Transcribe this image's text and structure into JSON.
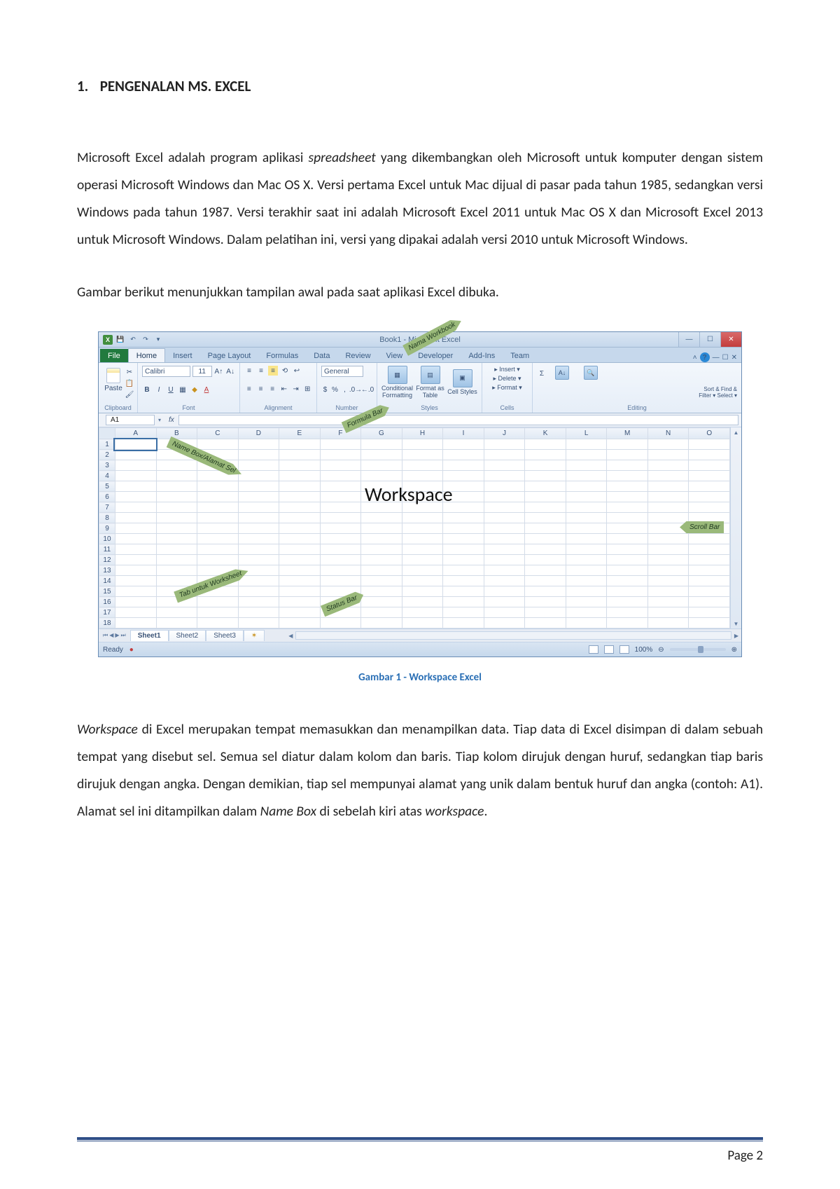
{
  "heading": {
    "number": "1.",
    "text": "PENGENALAN MS. EXCEL"
  },
  "para1_pre": "Microsoft Excel adalah program aplikasi ",
  "para1_it1": "spreadsheet",
  "para1_post": " yang dikembangkan oleh Microsoft untuk komputer dengan sistem operasi Microsoft Windows dan Mac OS X. Versi pertama Excel untuk Mac dijual di pasar pada tahun 1985, sedangkan versi Windows pada tahun 1987. Versi terakhir saat ini adalah Microsoft Excel 2011 untuk Mac OS X dan Microsoft Excel 2013 untuk Microsoft Windows. Dalam pelatihan ini, versi yang dipakai adalah versi 2010 untuk Microsoft Windows.",
  "para2": "Gambar berikut menunjukkan tampilan awal pada saat aplikasi Excel dibuka.",
  "caption": "Gambar 1 - Workspace Excel",
  "para3": {
    "it1": "Workspace",
    "seg1": " di Excel merupakan tempat memasukkan dan menampilkan data. Tiap data di Excel disimpan di dalam sebuah tempat yang disebut sel. Semua sel diatur dalam kolom dan baris. Tiap kolom dirujuk dengan huruf, sedangkan tiap baris dirujuk dengan angka. Dengan demikian, tiap sel mempunyai alamat yang unik dalam bentuk huruf dan angka (contoh: A1). Alamat sel ini ditampilkan dalam ",
    "it2": "Name Box",
    "seg2": " di sebelah kiri atas ",
    "it3": "workspace",
    "seg3": "."
  },
  "page_num": "Page 2",
  "excel": {
    "title": "Book1 - Microsoft Excel",
    "tabs": [
      "File",
      "Home",
      "Insert",
      "Page Layout",
      "Formulas",
      "Data",
      "Review",
      "View",
      "Developer",
      "Add-Ins",
      "Team"
    ],
    "active_tab": "Home",
    "groups": {
      "clipboard": "Clipboard",
      "paste": "Paste",
      "font": "Font",
      "font_name": "Calibri",
      "font_size": "11",
      "alignment": "Alignment",
      "number": "Number",
      "number_format": "General",
      "styles": "Styles",
      "cond_fmt": "Conditional Formatting",
      "fmt_table": "Format as Table",
      "cell_styles": "Cell Styles",
      "cells": "Cells",
      "insert": "Insert",
      "delete": "Delete",
      "format": "Format",
      "editing": "Editing",
      "sort_find": "Sort & Find &",
      "filter_select": "Filter ▾ Select ▾"
    },
    "namebox": "A1",
    "fx": "fx",
    "cols": [
      "A",
      "B",
      "C",
      "D",
      "E",
      "F",
      "G",
      "H",
      "I",
      "J",
      "K",
      "L",
      "M",
      "N",
      "O"
    ],
    "rows": [
      "1",
      "2",
      "3",
      "4",
      "5",
      "6",
      "7",
      "8",
      "9",
      "10",
      "11",
      "12",
      "13",
      "14",
      "15",
      "16",
      "17",
      "18"
    ],
    "sheets": [
      "Sheet1",
      "Sheet2",
      "Sheet3"
    ],
    "status_ready": "Ready",
    "zoom": "100%"
  },
  "annotations": {
    "nama_workbook": "Nama Workbook",
    "formula_bar": "Formula Bar",
    "namebox": "Name Box/Alamat Sel",
    "workspace": "Workspace",
    "scrollbar": "Scroll Bar",
    "tab_worksheet": "Tab untuk Worksheet",
    "status_bar": "Status Bar"
  }
}
